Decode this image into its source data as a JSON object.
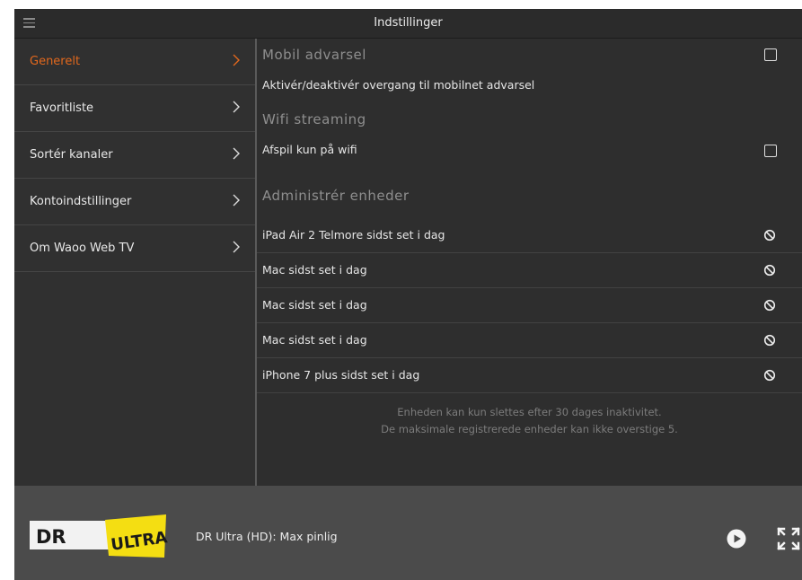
{
  "header": {
    "title": "Indstillinger",
    "menu_icon": "hamburger-menu-icon"
  },
  "sidebar": {
    "items": [
      {
        "label": "Generelt",
        "active": true
      },
      {
        "label": "Favoritliste",
        "active": false
      },
      {
        "label": "Sortér kanaler",
        "active": false
      },
      {
        "label": "Kontoindstillinger",
        "active": false
      },
      {
        "label": "Om Waoo Web TV",
        "active": false
      }
    ],
    "chevron_icon": "chevron-right-icon"
  },
  "content": {
    "mobile_warning": {
      "title": "Mobil advarsel",
      "description": "Aktivér/deaktivér overgang til mobilnet advarsel",
      "checked": false
    },
    "wifi_streaming": {
      "title": "Wifi streaming",
      "option_label": "Afspil kun på wifi",
      "checked": false
    },
    "devices": {
      "title": "Administrér enheder",
      "items": [
        {
          "label": "iPad Air 2 Telmore sidst set i dag"
        },
        {
          "label": "Mac sidst set i dag"
        },
        {
          "label": "Mac sidst set i dag"
        },
        {
          "label": "Mac sidst set i dag"
        },
        {
          "label": "iPhone 7 plus sidst set i dag"
        }
      ],
      "remove_icon": "block-icon",
      "note_line1": "Enheden kan kun slettes efter 30 dages inaktivitet.",
      "note_line2": "De maksimale registrerede enheder kan ikke overstige 5."
    }
  },
  "player": {
    "logo_text_dr": "DR",
    "logo_text_ultra": "ULTRA",
    "program_title": "DR Ultra (HD): Max pinlig",
    "play_icon": "play-icon",
    "fullscreen_icon": "fullscreen-icon"
  },
  "colors": {
    "accent": "#e2681d",
    "logo_yellow": "#f4de12",
    "background": "#2e2e2e",
    "player_bar": "#4b4b4b"
  }
}
